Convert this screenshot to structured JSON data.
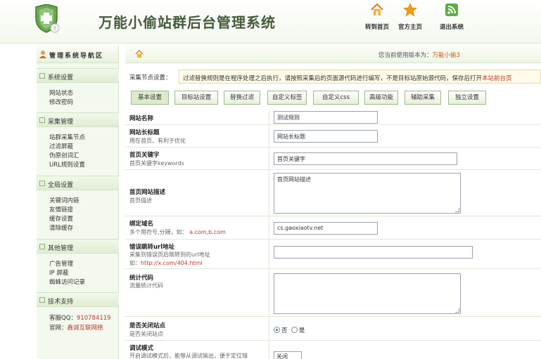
{
  "header": {
    "title": "万能小偷站群后台管理系统",
    "nav": [
      {
        "label": "转到首页",
        "icon": "home-icon"
      },
      {
        "label": "官方主页",
        "icon": "star-icon"
      },
      {
        "label": "退出系统",
        "icon": "rss-icon"
      }
    ]
  },
  "sidebar": {
    "title": "管理系统导航区",
    "sections": [
      {
        "label": "系统设置",
        "items": [
          "网站状态",
          "修改密码"
        ]
      },
      {
        "label": "采集管理",
        "items": [
          "站群采集节点",
          "过滤屏蔽",
          "伪原创词汇",
          "URL规则设置"
        ]
      },
      {
        "label": "全局设置",
        "items": [
          "关键词内链",
          "友情链接",
          "缓存设置",
          "清除缓存"
        ]
      },
      {
        "label": "其他管理",
        "items": [
          "广告管理",
          "IP 屏蔽",
          "蜘蛛访问记录"
        ]
      },
      {
        "label": "技术支持",
        "items": []
      }
    ],
    "support": {
      "qq_label": "客服QQ：",
      "qq_value": "910784119",
      "site_label": "官网：",
      "site_value": "鑫诚互联网络"
    }
  },
  "breadcrumb": {
    "version_label": "您当前使用版本为：",
    "version_value": "万能小偷3"
  },
  "notice": {
    "label": "采集节点设置：",
    "text": "过滤替换规则是在程序处理之后执行，请按照采集后的页面源代码进行编写，不是目标站原始源代码，保存后打开",
    "link": "本站前台页"
  },
  "tabs": [
    "基本设置",
    "目标站设置",
    "替换过滤",
    "自定义标签",
    "自定义css",
    "高级功能",
    "辅助采集",
    "独立设置"
  ],
  "form": {
    "site_name": {
      "label": "网站名称",
      "value": "测试规则"
    },
    "site_long_title": {
      "label": "网站长标题",
      "hint": "用在首页，有利于优化",
      "value": "网站长标题"
    },
    "home_keywords": {
      "label": "首页关键字",
      "hint": "首页关键字keywords",
      "value": "首页关键字"
    },
    "home_description": {
      "label": "首页网站描述",
      "hint": "首页描述",
      "value": "首页网站描述"
    },
    "bind_domain": {
      "label": "绑定域名",
      "hint": "多个用符号,分隔，如：",
      "hint_example": "a.com,b.com",
      "value": "cs.gaoxiaotv.net"
    },
    "error_redirect": {
      "label": "错误跳转url地址",
      "hint": "采集到错误页后跳转到的url地址",
      "hint2_prefix": "如：",
      "hint2_example": "http://x.com/404.html",
      "value": ""
    },
    "stat_code": {
      "label": "统计代码",
      "hint": "流量统计代码",
      "value": ""
    },
    "close_site": {
      "label": "是否关闭站点",
      "hint": "是否关闭站点",
      "opt_no": "否",
      "opt_yes": "是",
      "selected": "否"
    },
    "debug_mode": {
      "label": "调试模式",
      "hint": "开启调试模式后，能够从调试输出，便于定位错",
      "value": "关闭"
    }
  },
  "colors": {
    "accent": "#d35400",
    "link_red": "#c0392b",
    "border_green": "#9dbb84"
  }
}
